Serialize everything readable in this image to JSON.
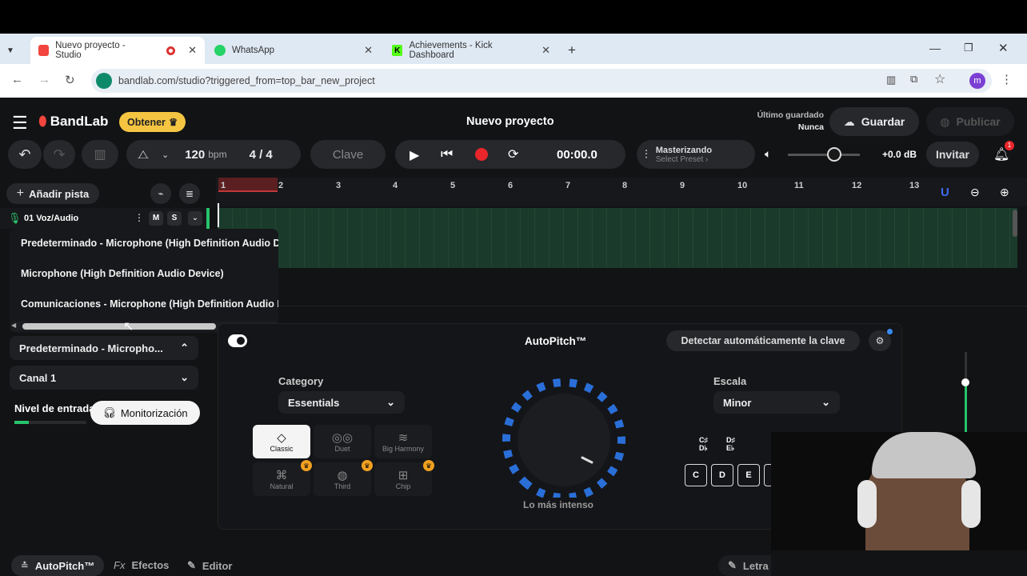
{
  "browser": {
    "tabs": [
      {
        "title": "Nuevo proyecto - Studio"
      },
      {
        "title": "WhatsApp"
      },
      {
        "title": "Achievements - Kick Dashboard"
      }
    ],
    "url": "bandlab.com/studio?triggered_from=top_bar_new_project",
    "profile_initial": "m",
    "new_tab": "+",
    "close": "✕"
  },
  "header": {
    "logo": "BandLab",
    "get_button": "Obtener",
    "project_title": "Nuevo proyecto",
    "last_saved_label": "Último guardado",
    "last_saved_value": "Nunca",
    "save_button": "Guardar",
    "publish_button": "Publicar"
  },
  "transport": {
    "tempo": "120",
    "tempo_unit": "bpm",
    "time_signature": "4 / 4",
    "key_button": "Clave",
    "time": "00:00.0",
    "mastering_title": "Masterizando",
    "mastering_preset": "Select Preset ›",
    "volume_db": "+0.0 dB",
    "invite_button": "Invitar",
    "notification_count": "1"
  },
  "tracks": {
    "add_track": "Añadir pista",
    "track_name": "01  Voz/Audio",
    "mute": "M",
    "solo": "S"
  },
  "ruler": [
    "1",
    "2",
    "3",
    "4",
    "5",
    "6",
    "7",
    "8",
    "9",
    "10",
    "11",
    "12",
    "13"
  ],
  "input_dropdown": {
    "options": [
      "Predeterminado - Microphone (High Definition Audio Device)",
      "Microphone (High Definition Audio Device)",
      "Comunicaciones - Microphone (High Definition Audio Device)"
    ]
  },
  "input_panel": {
    "selected_input": "Predeterminado - Micropho...",
    "channel": "Canal 1",
    "input_level_label": "Nivel de entrada",
    "monitoring_button": "Monitorización"
  },
  "autopitch": {
    "title": "AutoPitch™",
    "detect_key_button": "Detectar automáticamente la clave",
    "category_label": "Category",
    "category_value": "Essentials",
    "presets": [
      "Classic",
      "Duet",
      "Big Harmony",
      "Natural",
      "Third",
      "Chip"
    ],
    "knob_label": "Lo más intenso",
    "scale_label": "Escala",
    "scale_value": "Minor",
    "sharp_keys": [
      "C♯\nD♭",
      "D♯\nE♭"
    ],
    "keys": [
      "C",
      "D",
      "E"
    ]
  },
  "bottom_tabs": [
    "AutoPitch™",
    "Efectos",
    "Editor",
    "Letra"
  ],
  "bottom_tab_fx": "Fx",
  "colors": {
    "accent": "#f2453d",
    "gold": "#f5c542",
    "record": "#e8262b",
    "track_green": "#1a3b2b",
    "bandlab_red": "#f2453d"
  }
}
